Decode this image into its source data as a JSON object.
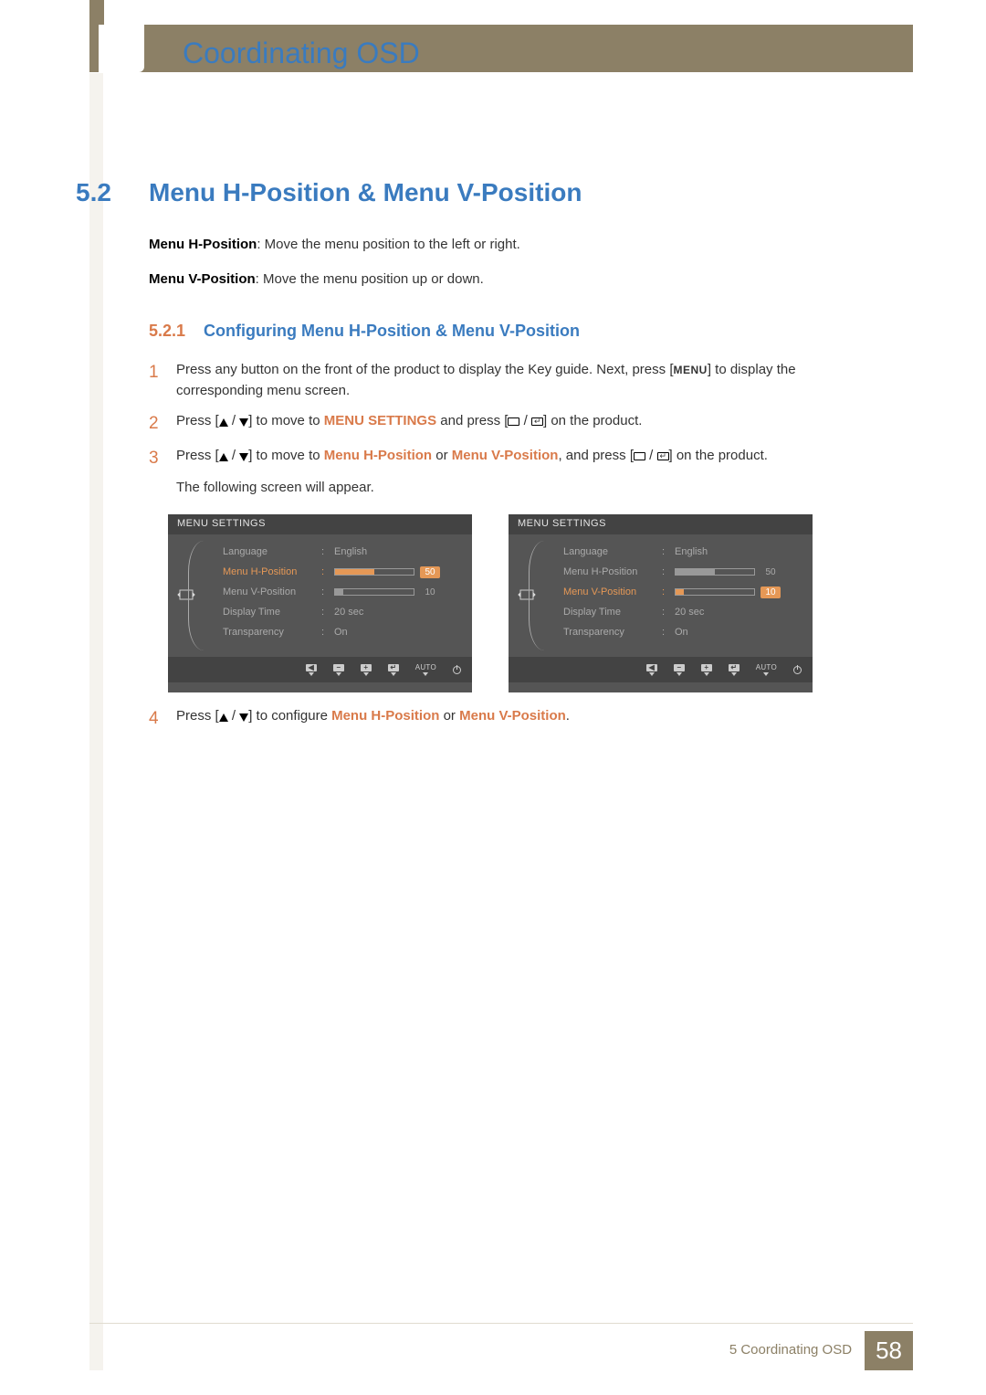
{
  "chapter_title": "Coordinating OSD",
  "section_number": "5.2",
  "section_title": "Menu H-Position & Menu V-Position",
  "p1_term": "Menu H-Position",
  "p1_rest": ": Move the menu position to the left or right.",
  "p2_term": "Menu V-Position",
  "p2_rest": ": Move the menu position up or down.",
  "sub_number": "5.2.1",
  "sub_title": "Configuring Menu H-Position & Menu V-Position",
  "steps": {
    "s1a": "Press any button on the front of the product to display the Key guide. Next, press [",
    "s1_key": "MENU",
    "s1b": "] to display the corresponding menu screen.",
    "s2a": "Press [",
    "s2b": "] to move to ",
    "s2_hl": "MENU SETTINGS",
    "s2c": " and press [",
    "s2d": "] on the product.",
    "s3a": "Press [",
    "s3b": "] to move to ",
    "s3_hl1": "Menu H-Position",
    "s3_mid": " or ",
    "s3_hl2": "Menu V-Position",
    "s3c": ", and press [",
    "s3d": "] on the product.",
    "s3_note": "The following screen will appear.",
    "s4a": "Press [",
    "s4b": "] to configure ",
    "s4_hl1": "Menu H-Position",
    "s4_mid": " or ",
    "s4_hl2": "Menu V-Position",
    "s4_end": "."
  },
  "osd": {
    "header": "MENU SETTINGS",
    "items": {
      "language_lbl": "Language",
      "language_val": "English",
      "h_lbl": "Menu H-Position",
      "h_val": "50",
      "v_lbl": "Menu V-Position",
      "v_val": "10",
      "disp_lbl": "Display Time",
      "disp_val": "20 sec",
      "trans_lbl": "Transparency",
      "trans_val": "On"
    },
    "foot_auto": "AUTO"
  },
  "footer_chapter": "5 Coordinating OSD",
  "footer_page": "58"
}
